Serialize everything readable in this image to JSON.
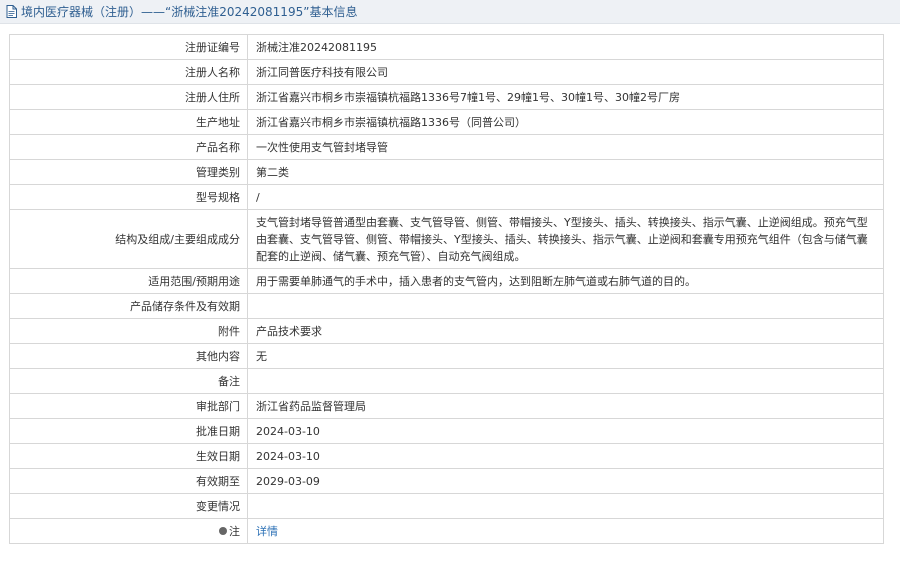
{
  "header": {
    "breadcrumb": "境内医疗器械（注册）",
    "separator": " ——",
    "title": "“浙械注准20242081195”",
    "suffix": " 基本信息"
  },
  "rows": [
    {
      "label": "注册证编号",
      "value": "浙械注准20242081195"
    },
    {
      "label": "注册人名称",
      "value": "浙江同普医疗科技有限公司"
    },
    {
      "label": "注册人住所",
      "value": "浙江省嘉兴市桐乡市崇福镇杭福路1336号7幢1号、29幢1号、30幢1号、30幢2号厂房"
    },
    {
      "label": "生产地址",
      "value": "浙江省嘉兴市桐乡市崇福镇杭福路1336号（同普公司）"
    },
    {
      "label": "产品名称",
      "value": "一次性使用支气管封堵导管"
    },
    {
      "label": "管理类别",
      "value": "第二类"
    },
    {
      "label": "型号规格",
      "value": "/"
    },
    {
      "label": "结构及组成/主要组成成分",
      "value": "支气管封堵导管普通型由套囊、支气管导管、侧管、带帽接头、Y型接头、插头、转换接头、指示气囊、止逆阀组成。预充气型由套囊、支气管导管、侧管、带帽接头、Y型接头、插头、转换接头、指示气囊、止逆阀和套囊专用预充气组件（包含与储气囊配套的止逆阀、储气囊、预充气管）、自动充气阀组成。"
    },
    {
      "label": "适用范围/预期用途",
      "value": "用于需要单肺通气的手术中，插入患者的支气管内，达到阻断左肺气道或右肺气道的目的。"
    },
    {
      "label": "产品储存条件及有效期",
      "value": ""
    },
    {
      "label": "附件",
      "value": "产品技术要求"
    },
    {
      "label": "其他内容",
      "value": "无"
    },
    {
      "label": "备注",
      "value": ""
    },
    {
      "label": "审批部门",
      "value": "浙江省药品监督管理局"
    },
    {
      "label": "批准日期",
      "value": "2024-03-10"
    },
    {
      "label": "生效日期",
      "value": "2024-03-10"
    },
    {
      "label": "有效期至",
      "value": "2029-03-09"
    },
    {
      "label": "变更情况",
      "value": ""
    }
  ],
  "note": {
    "label": "注",
    "link": "详情"
  },
  "icons": {
    "header": "document-icon",
    "note": "pin-icon"
  },
  "colors": {
    "header_text": "#2f5f91",
    "link": "#2a6fb5",
    "border": "#d7d7d7"
  }
}
